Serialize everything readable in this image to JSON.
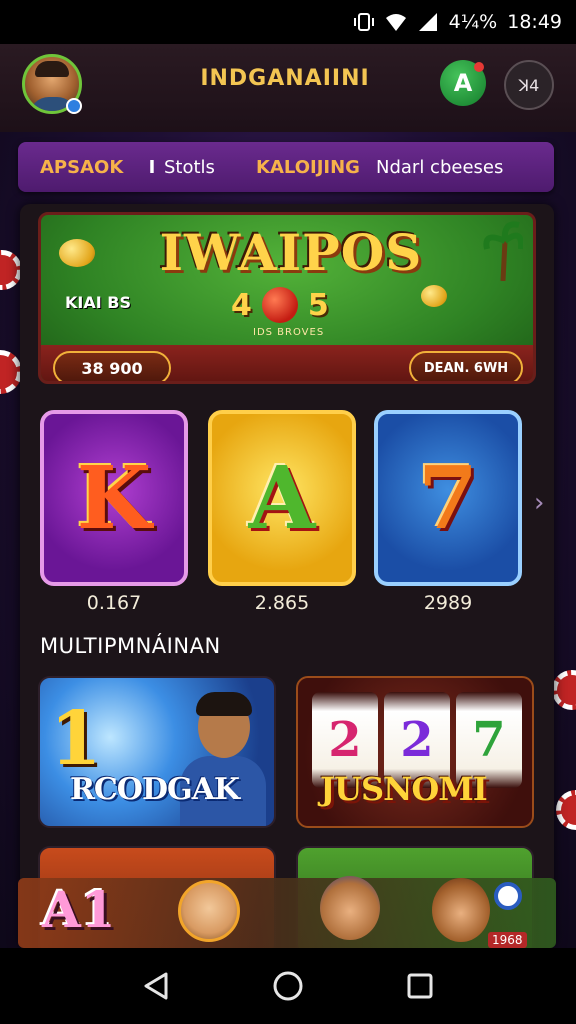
{
  "status_bar": {
    "battery": "4¼%",
    "time": "18:49"
  },
  "header": {
    "title": "INDGANAIINI",
    "green_button_label": "A",
    "grey_button_label": "ꓘ4"
  },
  "tabs": [
    {
      "label": "APSAOK"
    },
    {
      "label": "Stotls"
    },
    {
      "label": "KALOIJING"
    },
    {
      "label": "Ndarl cbeeses"
    }
  ],
  "tab_separator": "I",
  "banner": {
    "title": "IWAIPOS",
    "left_text": "KIAI BS",
    "center_left": "4",
    "center_right": "5",
    "subtext": "IDS BROVES",
    "left_pill": "38 900",
    "right_pill": "DEAN. 6WH"
  },
  "slot_tiles": [
    {
      "symbol": "K",
      "value": "0.167"
    },
    {
      "symbol": "A",
      "value": "2.865"
    },
    {
      "symbol": "7",
      "value": "2989"
    }
  ],
  "section_title": "MULTIPMNÁINAN",
  "game_cards": [
    {
      "big_number": "1",
      "label": "RCODGAK"
    },
    {
      "reels": [
        "2",
        "2",
        "7"
      ],
      "label": "JUSNOMI"
    }
  ],
  "bottom_strip": {
    "label": "A1",
    "chip_text": "1968"
  },
  "colors": {
    "accent_gold": "#f3c552",
    "tab_bar": "#5b2280",
    "panel": "#1c1419"
  }
}
